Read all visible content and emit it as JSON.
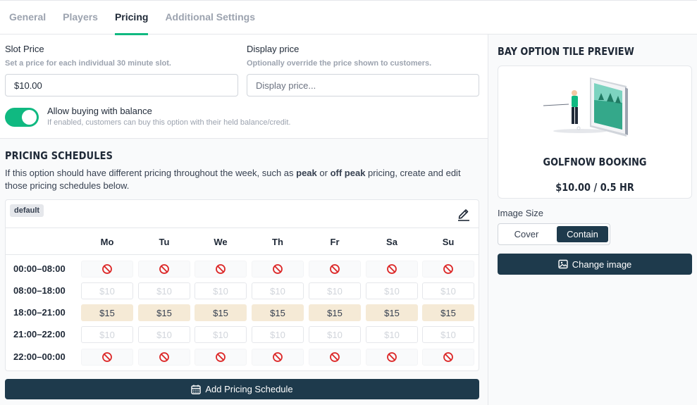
{
  "tabs": [
    {
      "label": "General",
      "active": false
    },
    {
      "label": "Players",
      "active": false
    },
    {
      "label": "Pricing",
      "active": true
    },
    {
      "label": "Additional Settings",
      "active": false
    }
  ],
  "slot_price": {
    "label": "Slot Price",
    "help": "Set a price for each individual 30 minute slot.",
    "value": "$10.00"
  },
  "display_price": {
    "label": "Display price",
    "help": "Optionally override the price shown to customers.",
    "placeholder": "Display price..."
  },
  "balance_toggle": {
    "label": "Allow buying with balance",
    "help": "If enabled, customers can buy this option with their held balance/credit.",
    "on": true
  },
  "schedules": {
    "title": "PRICING SCHEDULES",
    "desc_pre": "If this option should have different pricing throughout the week, such as ",
    "desc_peak": "peak",
    "desc_mid": " or ",
    "desc_offpeak": "off peak",
    "desc_post": " pricing, create and edit those pricing schedules below.",
    "badge": "default",
    "days": [
      "Mo",
      "Tu",
      "We",
      "Th",
      "Fr",
      "Sa",
      "Su"
    ],
    "rows": [
      {
        "time": "00:00–08:00",
        "kind": "closed",
        "price": ""
      },
      {
        "time": "08:00–18:00",
        "kind": "normal",
        "price": "$10"
      },
      {
        "time": "18:00–21:00",
        "kind": "peak",
        "price": "$15"
      },
      {
        "time": "21:00–22:00",
        "kind": "normal",
        "price": "$10"
      },
      {
        "time": "22:00–00:00",
        "kind": "closed",
        "price": ""
      }
    ],
    "add_label": "Add Pricing Schedule"
  },
  "preview": {
    "title": "BAY OPTION TILE PREVIEW",
    "name": "GOLFNOW BOOKING",
    "price": "$10.00 / 0.5 HR",
    "image_size_label": "Image Size",
    "cover_label": "Cover",
    "contain_label": "Contain",
    "change_image_label": "Change image"
  },
  "colors": {
    "accent": "#10b981",
    "primary": "#1e3a4c",
    "peak_bg": "#f5ead6",
    "closed_icon": "#dc2626"
  }
}
